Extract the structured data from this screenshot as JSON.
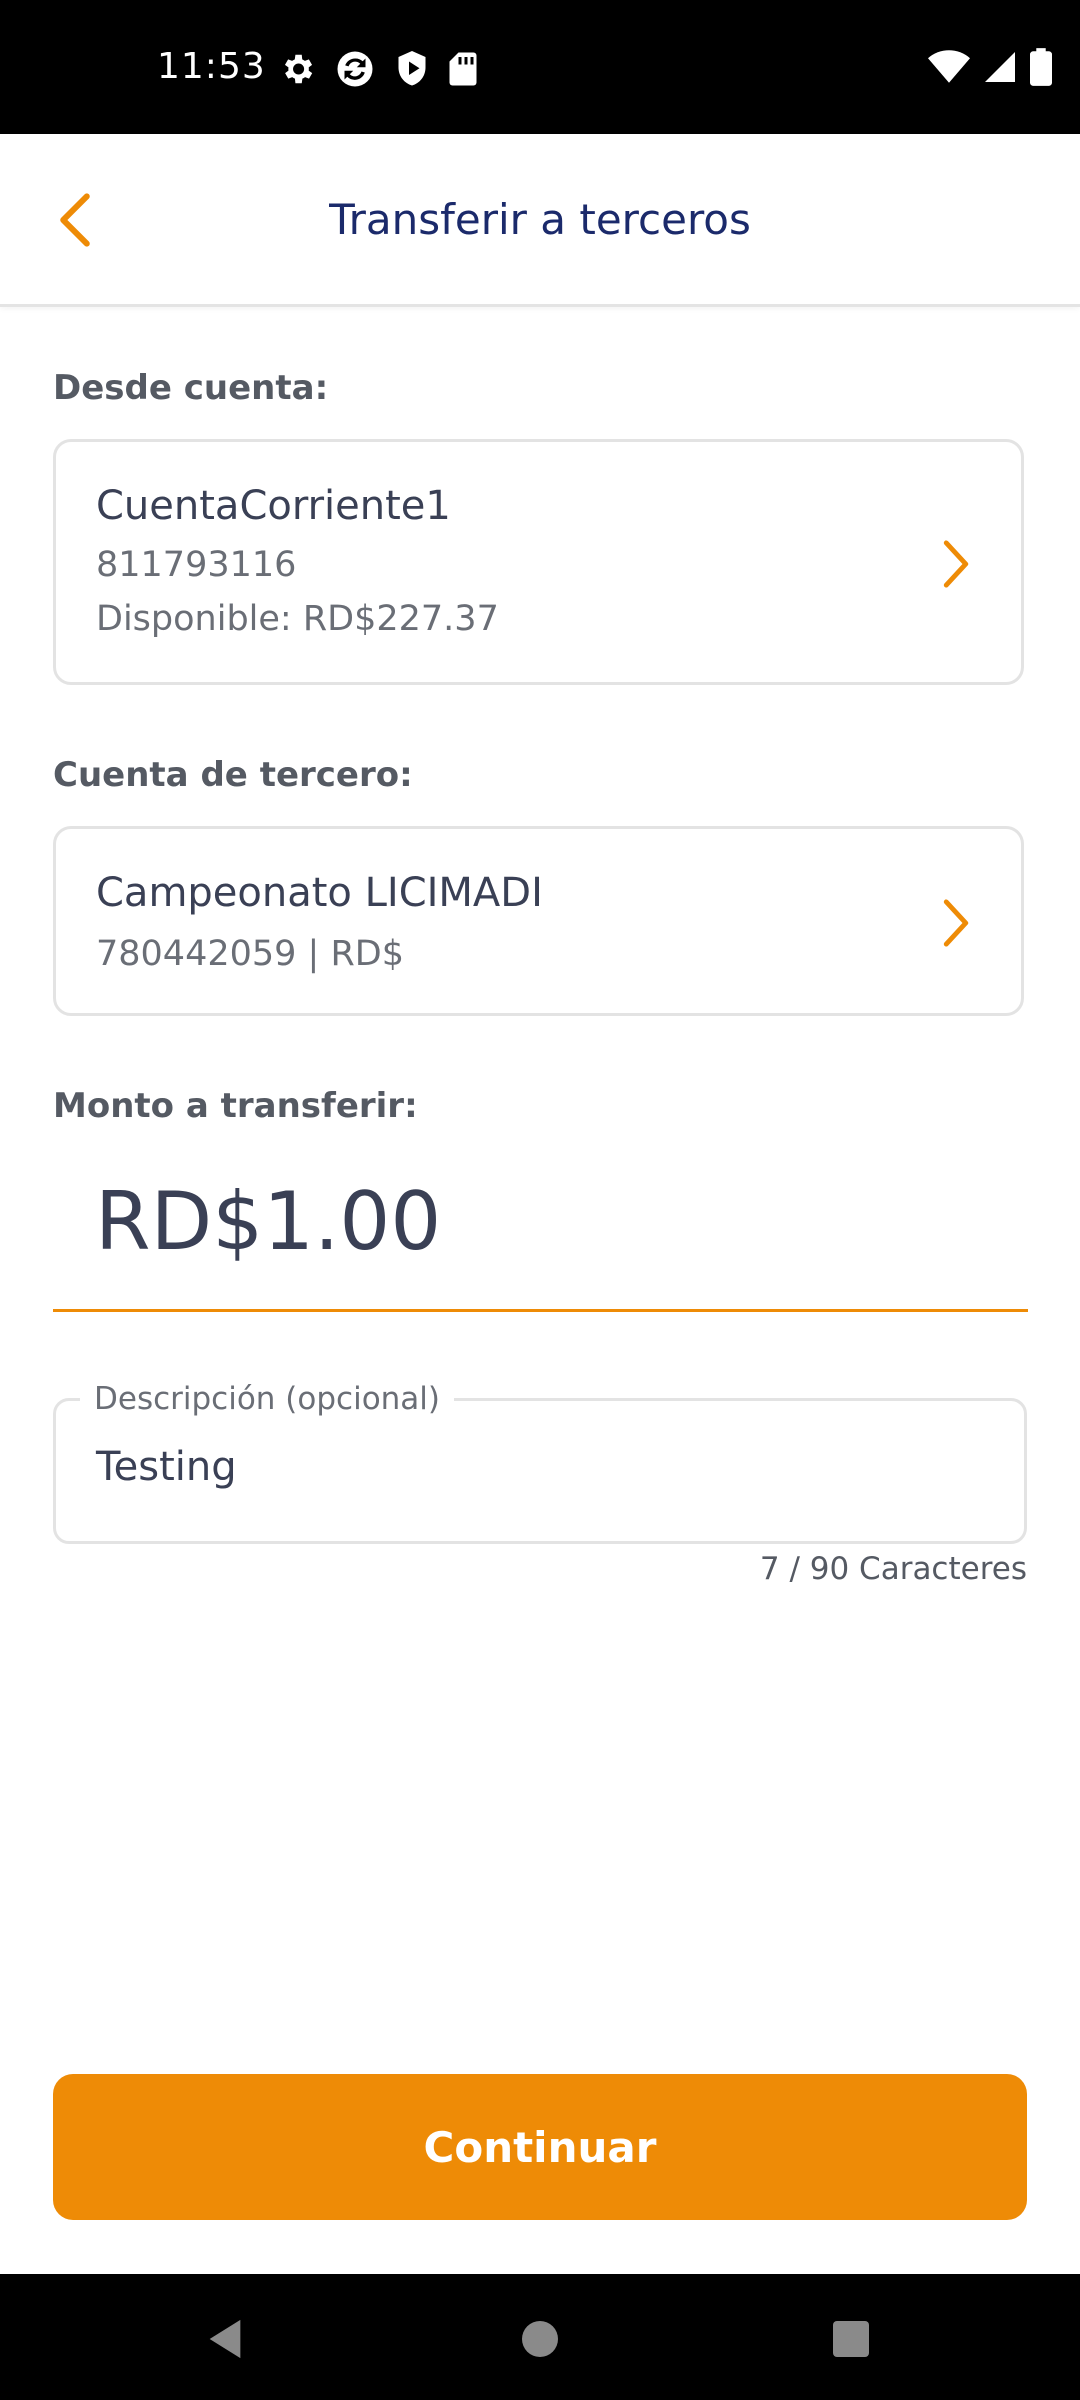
{
  "status_bar": {
    "time": "11:53",
    "left_icons": [
      "gear-icon",
      "sync-icon",
      "shield-play-icon",
      "sd-card-icon"
    ],
    "right_icons": [
      "wifi-icon",
      "cell-signal-icon",
      "battery-icon"
    ]
  },
  "header": {
    "title": "Transferir a terceros",
    "back_icon": "chevron-left-icon"
  },
  "from_account": {
    "label": "Desde cuenta:",
    "name": "CuentaCorriente1",
    "number": "811793116",
    "available": "Disponible: RD$227.37"
  },
  "to_account": {
    "label": "Cuenta de tercero:",
    "name": "Campeonato LICIMADI",
    "details": "780442059 | RD$"
  },
  "amount": {
    "label": "Monto a transferir:",
    "value": "RD$1.00"
  },
  "description": {
    "label": "Descripción (opcional)",
    "value": "Testing",
    "counter": "7 / 90 Caracteres"
  },
  "actions": {
    "continue_label": "Continuar"
  },
  "colors": {
    "accent": "#ee8b06",
    "title": "#1b2a6b",
    "text": "#3a4055"
  }
}
